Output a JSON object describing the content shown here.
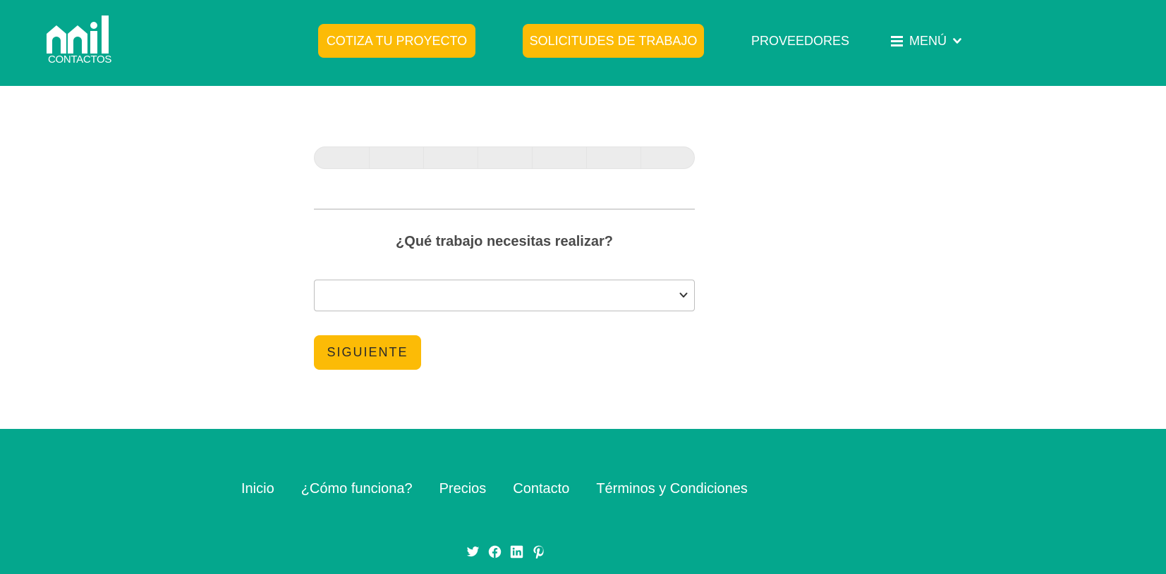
{
  "header": {
    "logo_text": "CONTACTOS",
    "nav": {
      "cotiza_label": "COTIZA TU PROYECTO",
      "solicitudes_label": "SOLICITUDES DE TRABAJO",
      "proveedores_label": "PROVEEDORES",
      "menu_label": "MENÚ"
    }
  },
  "form": {
    "progress": 0,
    "question": "¿Qué trabajo necesitas realizar?",
    "select_value": "",
    "next_label": "SIGUIENTE"
  },
  "footer": {
    "links": [
      "Inicio",
      "¿Cómo funciona?",
      "Precios",
      "Contacto",
      "Términos y Condiciones"
    ],
    "social_icons": [
      "twitter-icon",
      "facebook-icon",
      "linkedin-icon",
      "pinterest-icon"
    ]
  },
  "colors": {
    "brand_green": "#04a78d",
    "accent_yellow": "#fcbb06",
    "text_dark": "#4a4a4a"
  }
}
